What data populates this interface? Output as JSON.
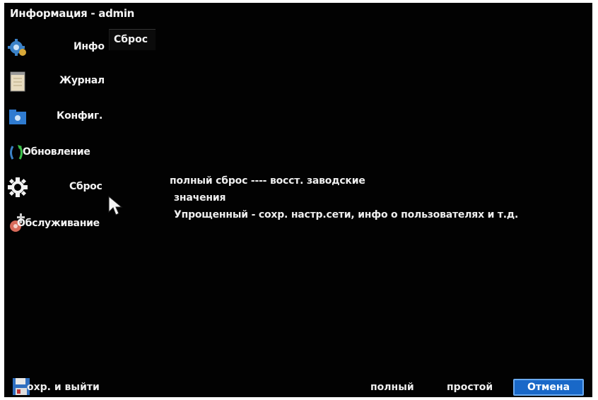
{
  "window": {
    "title": "Информация - admin"
  },
  "tab": {
    "active_label": "Сброс"
  },
  "sidebar": {
    "items": [
      {
        "label": "Инфо",
        "icon": "info-gear-icon"
      },
      {
        "label": "Журнал",
        "icon": "log-document-icon"
      },
      {
        "label": "Конфиг.",
        "icon": "config-folder-icon"
      },
      {
        "label": "Обновление",
        "icon": "update-arrows-icon"
      },
      {
        "label": "Сброс",
        "icon": "reset-gear-icon"
      },
      {
        "label": "Обслуживание",
        "icon": "maintenance-tools-icon"
      }
    ]
  },
  "description": {
    "line1": "полный сброс ---- восст. заводские",
    "line2": "значения",
    "line3": "Упрощенный  -  сохр. настр.сети, инфо о пользователях  и т.д."
  },
  "footer": {
    "save_exit_label": "охр. и выйти",
    "full_label": "полный",
    "simple_label": "простой",
    "cancel_label": "Отмена"
  },
  "colors": {
    "background": "#020202",
    "accent": "#1968c8",
    "text": "#f2f2f2"
  }
}
